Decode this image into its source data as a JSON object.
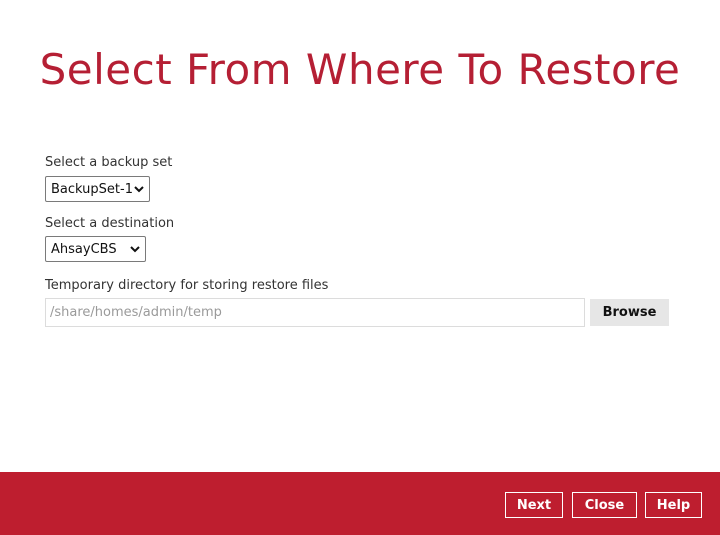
{
  "page": {
    "title": "Select From Where To Restore"
  },
  "backup_set": {
    "label": "Select a backup set",
    "selected": "BackupSet-1"
  },
  "destination": {
    "label": "Select a destination",
    "selected": "AhsayCBS"
  },
  "temp_dir": {
    "label": "Temporary directory for storing restore files",
    "value": "",
    "placeholder": "/share/homes/admin/temp",
    "browse_label": "Browse"
  },
  "footer": {
    "next_label": "Next",
    "close_label": "Close",
    "help_label": "Help"
  },
  "colors": {
    "accent": "#be1e2f",
    "title": "#b51f34"
  },
  "icons": {
    "dropdown": "chevron-down-icon"
  }
}
